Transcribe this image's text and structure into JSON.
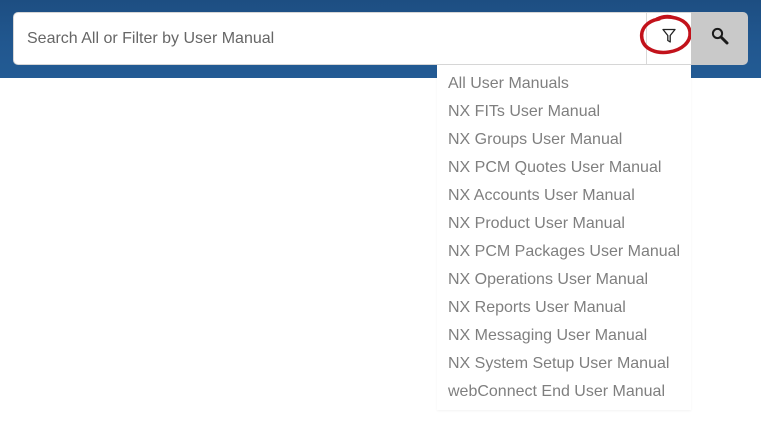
{
  "search": {
    "placeholder": "Search All or Filter by User Manual",
    "value": ""
  },
  "icons": {
    "filter": "filter-funnel-icon",
    "search": "magnifier-search-icon"
  },
  "colors": {
    "header": "#21578f",
    "annotation_ring": "#c2121b",
    "search_button_bg": "#c9c9c9",
    "menu_text": "#7f7f7f"
  },
  "filter_menu": {
    "items": [
      "All User Manuals",
      "NX FITs User Manual",
      "NX Groups User Manual",
      "NX PCM Quotes User Manual",
      "NX Accounts User Manual",
      "NX Product User Manual",
      "NX PCM Packages User Manual",
      "NX Operations User Manual",
      "NX Reports User Manual",
      "NX Messaging User Manual",
      "NX System Setup User Manual",
      "webConnect End User Manual"
    ]
  }
}
